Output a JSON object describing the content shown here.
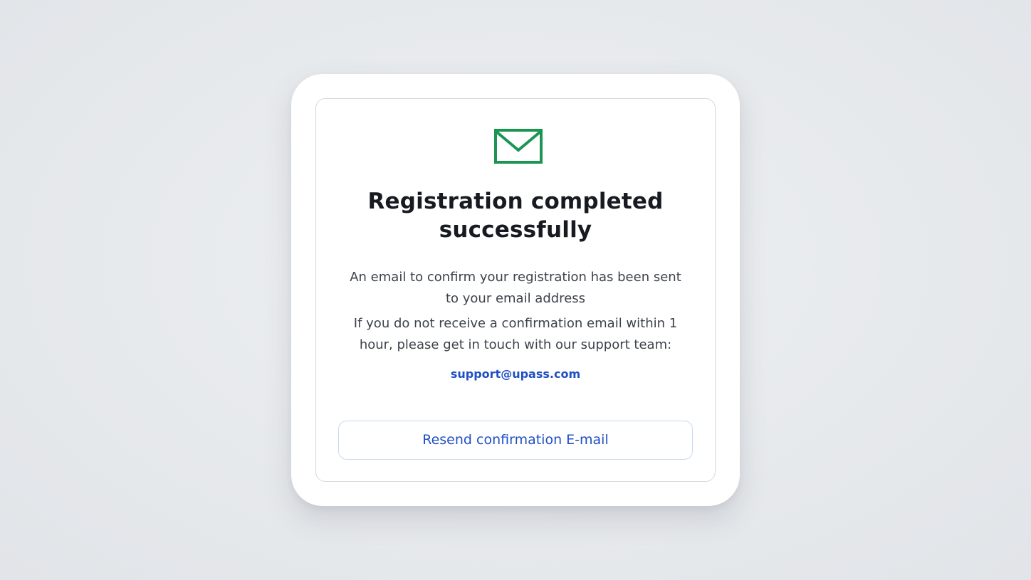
{
  "colors": {
    "accent_green": "#1a9652",
    "link_blue": "#1f4fc4",
    "title": "#171a21",
    "body_text": "#3c414b"
  },
  "icon": "mail-icon",
  "title": "Registration completed successfully",
  "message": {
    "sent": "An email to confirm your registration has been sent to your email address",
    "not_received": "If you do not receive a confirmation email within 1 hour, please get in touch with our support team:"
  },
  "support_email": "support@upass.com",
  "resend_button_label": "Resend confirmation E-mail"
}
